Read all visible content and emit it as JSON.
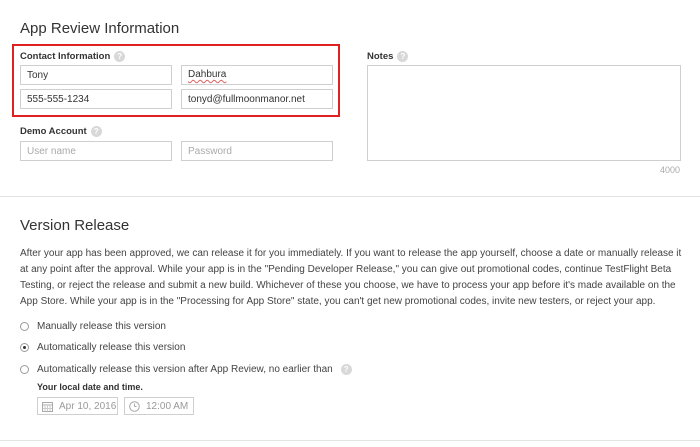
{
  "app_review": {
    "title": "App Review Information",
    "contact_label": "Contact Information",
    "first_name": "Tony",
    "last_name": "Dahbura",
    "phone": "555-555-1234",
    "email": "tonyd@fullmoonmanor.net",
    "demo_label": "Demo Account",
    "username_placeholder": "User name",
    "password_placeholder": "Password",
    "notes_label": "Notes",
    "notes_counter": "4000",
    "help_glyph": "?"
  },
  "version_release": {
    "title": "Version Release",
    "description": "After your app has been approved, we can release it for you immediately. If you want to release the app yourself, choose a date or manually release it at any point after the approval. While your app is in the \"Pending Developer Release,\" you can give out promotional codes, continue TestFlight Beta Testing, or reject the release and submit a new build. Whichever of these you choose, we have to process your app before it's made available on the App Store. While your app is in the \"Processing for App Store\" state, you can't get new promotional codes, invite new testers, or reject your app.",
    "options": [
      {
        "label": "Manually release this version",
        "checked": false
      },
      {
        "label": "Automatically release this version",
        "checked": true
      },
      {
        "label": "Automatically release this version after App Review, no earlier than",
        "checked": false
      }
    ],
    "local_date_label": "Your local date and time.",
    "date_value": "Apr 10, 2016",
    "time_value": "12:00 AM"
  },
  "colors": {
    "highlight": "#e02020"
  },
  "icons": [
    "help-icon",
    "calendar-icon",
    "clock-icon",
    "radio-icon"
  ]
}
